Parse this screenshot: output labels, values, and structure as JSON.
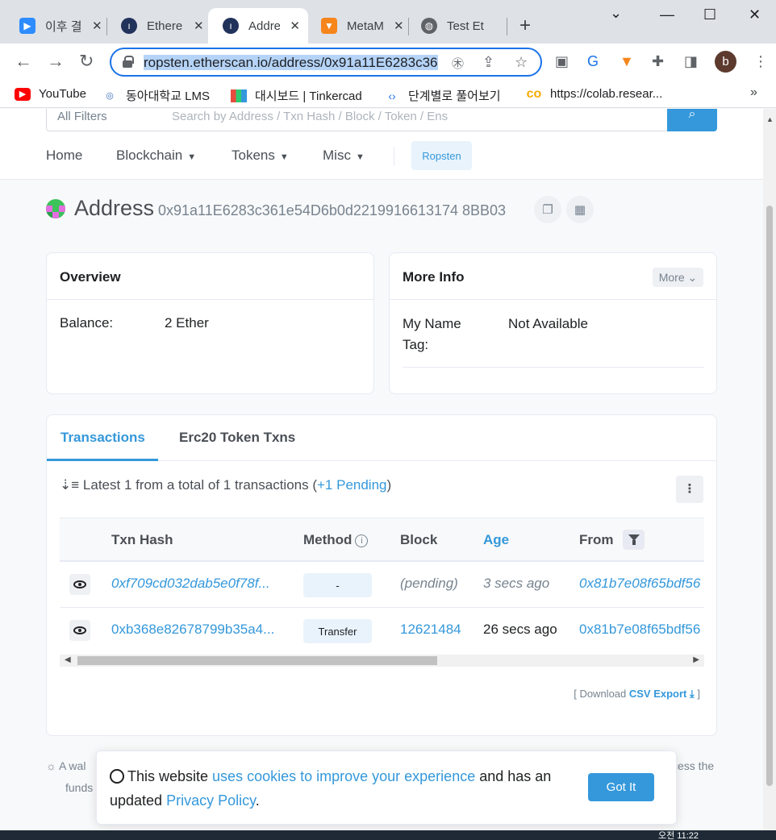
{
  "browser": {
    "tabs": [
      {
        "title": "이후 결",
        "icon": "zoom-icon"
      },
      {
        "title": "Ethere",
        "icon": "etherscan-icon"
      },
      {
        "title": "Addre",
        "icon": "etherscan-icon",
        "active": true
      },
      {
        "title": "MetaM",
        "icon": "metamask-fox-icon"
      },
      {
        "title": "Test Et",
        "icon": "globe-icon"
      }
    ],
    "url": "ropsten.etherscan.io/address/0x91a11E6283c361e54D6b0d2219916613174 8BB03",
    "url_visible": "ropsten.etherscan.io/address/0x91a11E6283c36",
    "bookmarks": [
      {
        "label": "YouTube",
        "icon": "youtube-icon"
      },
      {
        "label": "동아대학교 LMS",
        "icon": "donga-icon"
      },
      {
        "label": "대시보드 | Tinkercad",
        "icon": "tinkercad-icon"
      },
      {
        "label": "단계별로 풀어보기",
        "icon": "code-icon"
      },
      {
        "label": "https://colab.resear...",
        "icon": "colab-icon"
      }
    ],
    "avatar_initial": "b"
  },
  "site": {
    "filter_label": "All Filters",
    "search_placeholder": "Search by Address / Txn Hash / Block / Token / Ens",
    "nav": [
      "Home",
      "Blockchain",
      "Tokens",
      "Misc"
    ],
    "network_badge": "Ropsten"
  },
  "address": {
    "title": "Address",
    "hash": "0x91a11E6283c361e54D6b0d2219916613174 8BB03"
  },
  "overview": {
    "heading": "Overview",
    "balance_label": "Balance:",
    "balance_value": "2 Ether"
  },
  "more_info": {
    "heading": "More Info",
    "more_button": "More",
    "name_tag_label_1": "My Name",
    "name_tag_label_2": "Tag:",
    "name_tag_value": "Not Available"
  },
  "transactions": {
    "tabs": [
      "Transactions",
      "Erc20 Token Txns"
    ],
    "summary_prefix": "Latest 1 from a total of 1 transactions (",
    "summary_pending": "+1 Pending",
    "summary_suffix": ")",
    "columns": [
      "Txn Hash",
      "Method",
      "Block",
      "Age",
      "From"
    ],
    "rows": [
      {
        "hash": "0xf709cd032dab5e0f78f...",
        "method": "-",
        "block": "(pending)",
        "age": "3 secs ago",
        "from": "0x81b7e08f65bdf56"
      },
      {
        "hash": "0xb368e82678799b35a4...",
        "method": "Transfer",
        "block": "12621484",
        "age": "26 secs ago",
        "from": "0x81b7e08f65bdf56"
      }
    ],
    "download_prefix": "[ Download ",
    "download_link": "CSV Export",
    "download_suffix": " ]"
  },
  "tip": {
    "line1_start": "A wal",
    "line1_end": "ccess the",
    "line2_start": "funds"
  },
  "cookie": {
    "text_1": "This website ",
    "link_1": "uses cookies to improve your experience",
    "text_2": " and has an updated ",
    "link_2": "Privacy Policy",
    "text_3": ".",
    "button": "Got It"
  },
  "taskbar": {
    "clock": "오전 11:22"
  },
  "colors": {
    "accent": "#3498db",
    "chrome_focus": "#1a73e8"
  }
}
